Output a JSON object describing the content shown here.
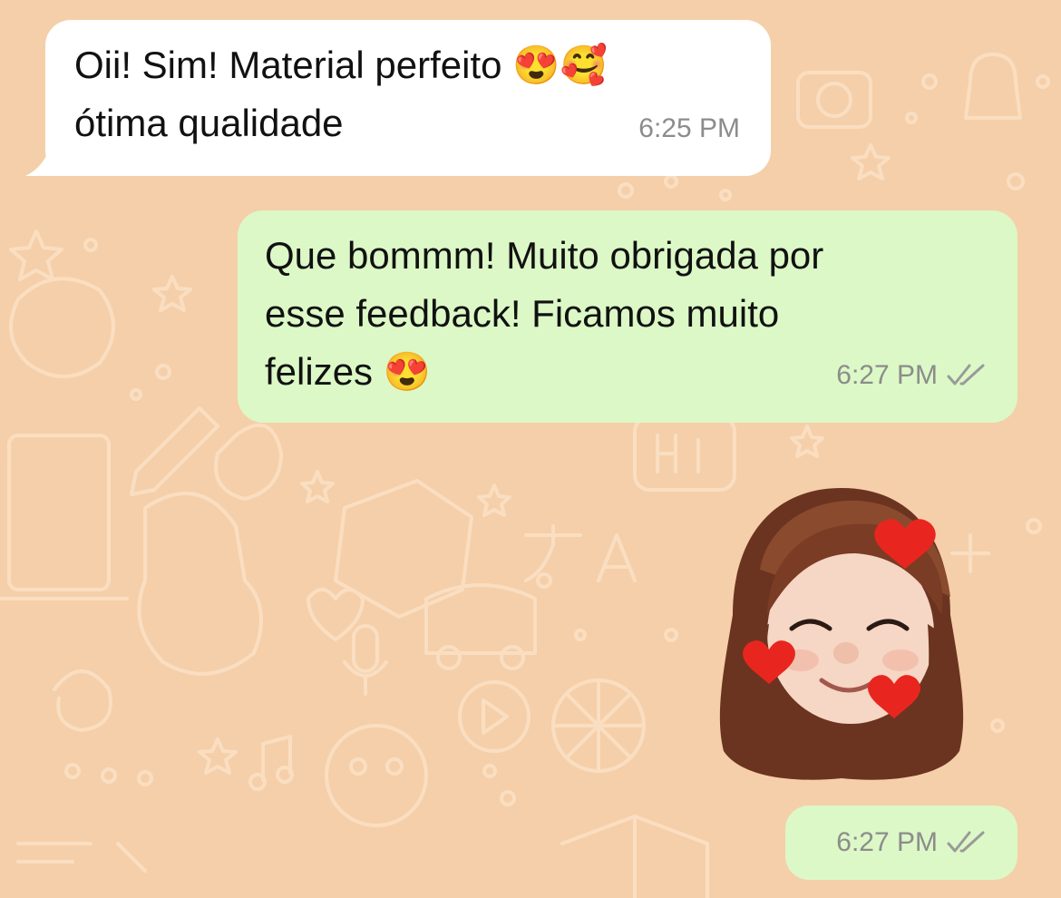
{
  "chat": {
    "background_color": "#f5cfa9",
    "incoming_bubble_color": "#ffffff",
    "outgoing_bubble_color": "#dcf8c6",
    "messages": [
      {
        "direction": "incoming",
        "text_line1": "Oii! Sim! Material perfeito",
        "emojis": "😍🥰",
        "text_line2": "ótima qualidade",
        "time": "6:25 PM"
      },
      {
        "direction": "outgoing",
        "text": "Que bommm! Muito obrigada por\nesse feedback! Ficamos muito\nfelizes",
        "emoji": "😍",
        "time": "6:27 PM",
        "status_icon": "double-check-icon"
      },
      {
        "direction": "outgoing",
        "type": "sticker",
        "sticker_icon": "memoji-heart-eyes-sticker",
        "time": "6:27 PM",
        "status_icon": "double-check-icon"
      }
    ]
  }
}
